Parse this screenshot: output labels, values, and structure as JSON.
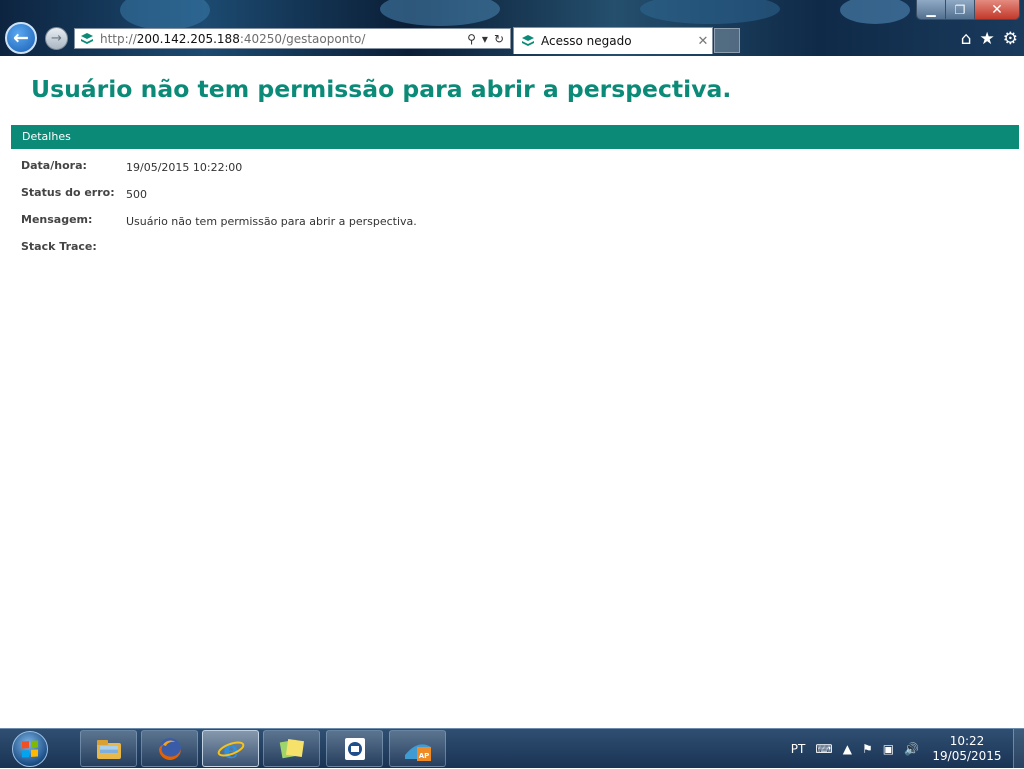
{
  "browser": {
    "address": {
      "scheme": "http://",
      "host": "200.142.205.188",
      "port_path": ":40250/gestaoponto/"
    },
    "tab": {
      "title": "Acesso negado"
    },
    "window_controls": {
      "minimize": "▁",
      "restore": "❐",
      "close": "✕"
    },
    "icons": [
      "back-arrow-icon",
      "forward-arrow-icon",
      "site-favicon",
      "search-icon",
      "refresh-icon",
      "home-icon",
      "favorites-star-icon",
      "settings-gear-icon"
    ]
  },
  "page": {
    "heading": "Usuário não tem permissão para abrir a perspectiva.",
    "details_title": "Detalhes",
    "details": [
      {
        "label": "Data/hora:",
        "value": "19/05/2015 10:22:00"
      },
      {
        "label": "Status do erro:",
        "value": "500"
      },
      {
        "label": "Mensagem:",
        "value": "Usuário não tem permissão para abrir a perspectiva."
      },
      {
        "label": "Stack Trace:",
        "value": ""
      }
    ],
    "colors": {
      "accent": "#0b8a78"
    }
  },
  "taskbar": {
    "apps": [
      "file-explorer-icon",
      "firefox-icon",
      "internet-explorer-icon",
      "sticky-notes-icon",
      "remote-desktop-icon",
      "ap-app-icon"
    ],
    "tray": {
      "language": "PT",
      "time": "10:22",
      "date": "19/05/2015"
    }
  }
}
